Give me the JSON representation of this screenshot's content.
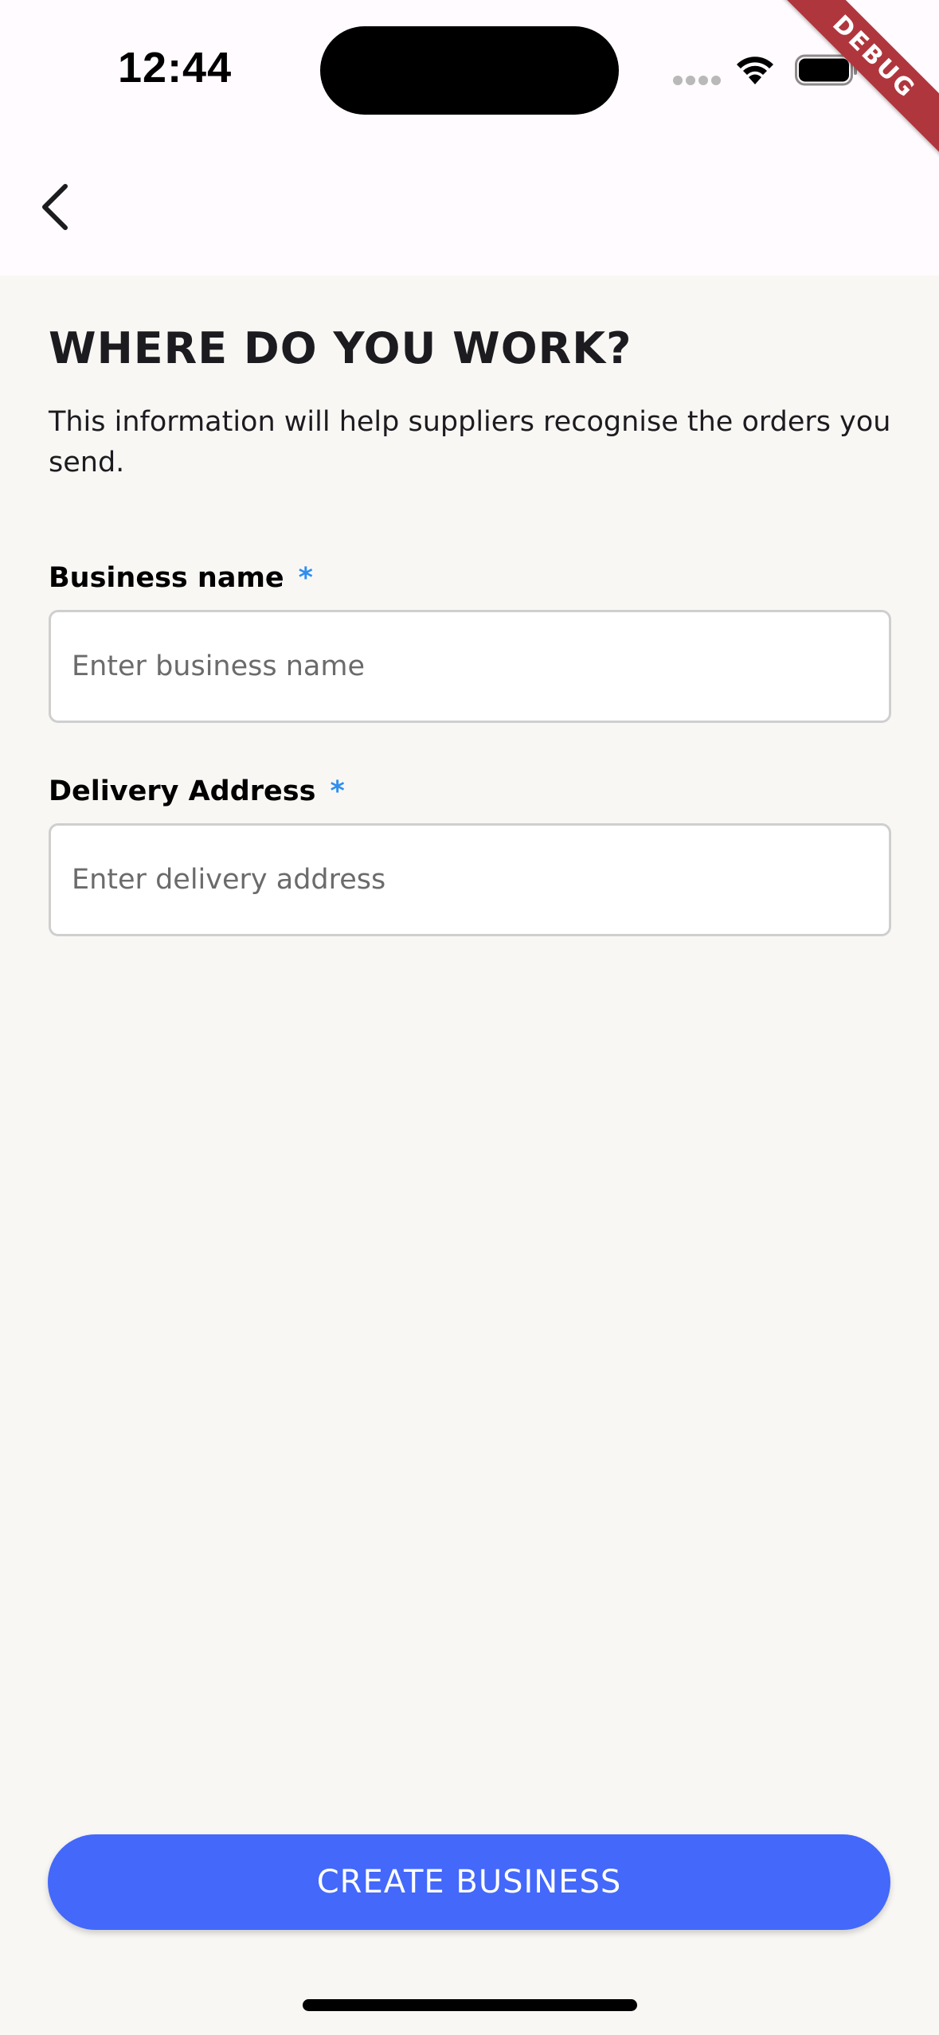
{
  "status_bar": {
    "time": "12:44",
    "debug_label": "DEBUG"
  },
  "nav": {
    "back_icon": "chevron-left-icon"
  },
  "page": {
    "title": "WHERE DO YOU WORK?",
    "subtitle": "This information will help suppliers recognise the orders you send."
  },
  "form": {
    "business_name": {
      "label": "Business name",
      "required_mark": "*",
      "placeholder": "Enter business name",
      "value": ""
    },
    "delivery_address": {
      "label": "Delivery Address",
      "required_mark": "*",
      "placeholder": "Enter delivery address",
      "value": ""
    }
  },
  "actions": {
    "create_label": "CREATE BUSINESS"
  },
  "colors": {
    "accent": "#4368fa",
    "required": "#2f8ef0",
    "background": "#f9f7f4",
    "header_background": "#fffbfe",
    "debug_ribbon": "#b0363d"
  }
}
